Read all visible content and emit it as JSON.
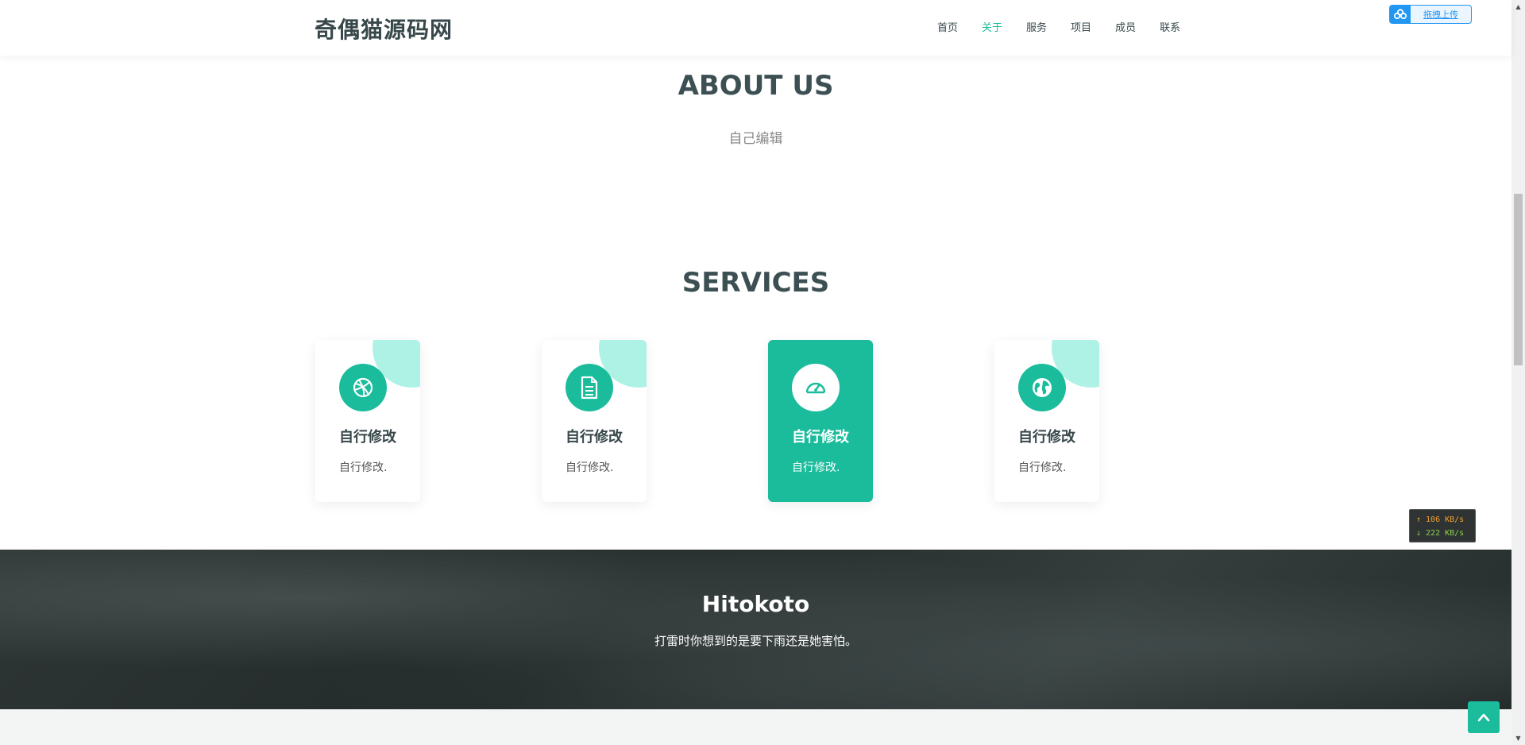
{
  "header": {
    "logo": "奇偶猫源码网",
    "nav": [
      {
        "label": "首页",
        "active": false
      },
      {
        "label": "关于",
        "active": true
      },
      {
        "label": "服务",
        "active": false
      },
      {
        "label": "项目",
        "active": false
      },
      {
        "label": "成员",
        "active": false
      },
      {
        "label": "联系",
        "active": false
      }
    ],
    "upload_label": "拖拽上传"
  },
  "about": {
    "title": "ABOUT US",
    "subtitle": "自己编辑"
  },
  "services": {
    "title": "SERVICES",
    "cards": [
      {
        "icon": "dribbble-icon",
        "title": "自行修改",
        "desc": "自行修改.",
        "active": false
      },
      {
        "icon": "document-icon",
        "title": "自行修改",
        "desc": "自行修改.",
        "active": false
      },
      {
        "icon": "dashboard-icon",
        "title": "自行修改",
        "desc": "自行修改.",
        "active": true
      },
      {
        "icon": "globe-icon",
        "title": "自行修改",
        "desc": "自行修改.",
        "active": false
      }
    ]
  },
  "hitokoto": {
    "title": "Hitokoto",
    "text": "打雷时你想到的是要下雨还是她害怕。"
  },
  "speed": {
    "up": "↑ 106 KB/s",
    "down": "↓ 222 KB/s"
  },
  "colors": {
    "accent": "#1abc9c",
    "accent_light": "#aef2e6",
    "heading": "#3c4f52",
    "upload_blue": "#2196f3"
  }
}
